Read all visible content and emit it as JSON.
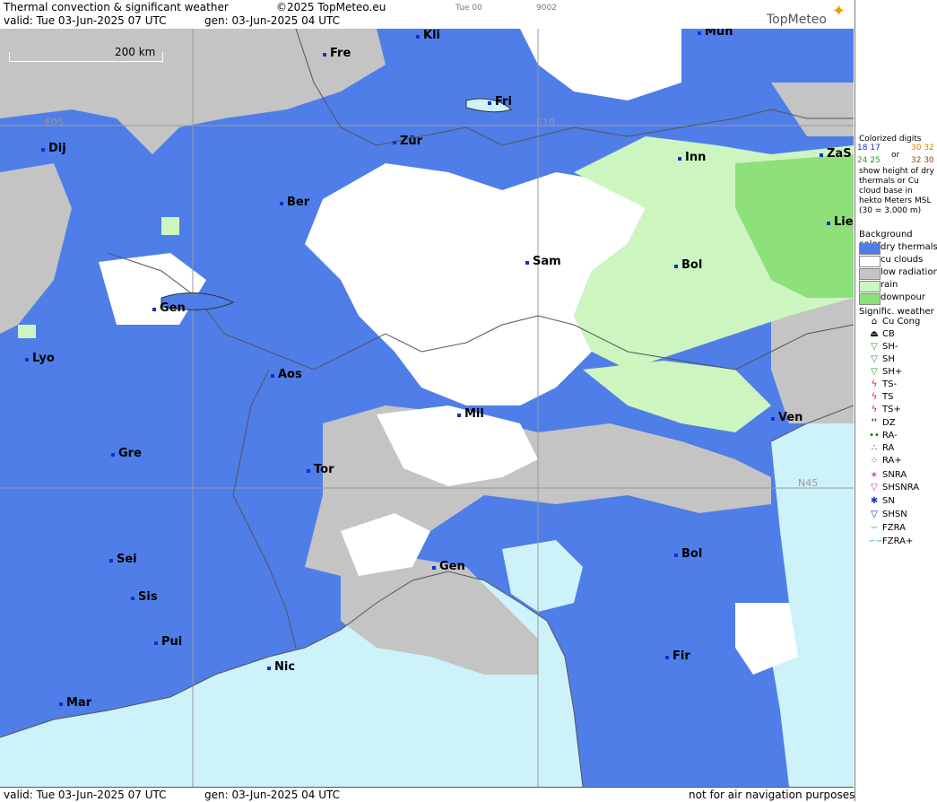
{
  "header": {
    "title": "Thermal convection & significant weather",
    "copyright": "©2025 TopMeteo.eu",
    "time_code": "Tue 00",
    "code": "9002",
    "valid": "valid:  Tue  03-Jun-2025  07 UTC",
    "gen": "gen: 03-Jun-2025 04 UTC",
    "logo": "TopMeteo"
  },
  "footer": {
    "valid": "valid:  Tue  03-Jun-2025  07 UTC",
    "gen": "gen: 03-Jun-2025 04 UTC",
    "note": "not for air navigation purposes"
  },
  "map": {
    "scale_label": "200 km",
    "grid_labels": [
      "E05",
      "E10",
      "N45"
    ],
    "colors": {
      "dry_thermals": "#4f7ee8",
      "cu_clouds": "#ffffff",
      "low_radiation": "#c4c4c4",
      "rain": "#cdf5c0",
      "downpour": "#8ee07a",
      "sea": "#cdf2fa"
    },
    "cities": [
      "Mun",
      "Kli",
      "Fre",
      "Fri",
      "Dij",
      "Zür",
      "Inn",
      "ZaS",
      "Ber",
      "Lie",
      "Sam",
      "Bol",
      "Gen",
      "Lyo",
      "Aos",
      "Mil",
      "Ven",
      "Gre",
      "Tor",
      "Sei",
      "Gen",
      "Bol",
      "Sis",
      "Pui",
      "Nic",
      "Fir",
      "Mar"
    ]
  },
  "legend": {
    "colorized_title": "Colorized digits",
    "colorized_samples": [
      "18 17",
      "30 32",
      "32 30",
      "24 25"
    ],
    "or": "or",
    "colorized_desc": "show height of dry thermals or Cu cloud base in hekto Meters MSL (30 = 3.000 m)",
    "bg_title": "Background color",
    "bg_items": [
      "dry thermals",
      "cu clouds",
      "low radiation",
      "rain",
      "downpour"
    ],
    "sig_title": "Signific. weather",
    "sig_items": [
      {
        "label": "Cu Cong",
        "icon": "cu-cong-icon"
      },
      {
        "label": "CB",
        "icon": "cb-icon"
      },
      {
        "label": "SH-",
        "icon": "shower-light-icon"
      },
      {
        "label": "SH",
        "icon": "shower-icon"
      },
      {
        "label": "SH+",
        "icon": "shower-heavy-icon"
      },
      {
        "label": "TS-",
        "icon": "thunderstorm-light-icon"
      },
      {
        "label": "TS",
        "icon": "thunderstorm-icon"
      },
      {
        "label": "TS+",
        "icon": "thunderstorm-heavy-icon"
      },
      {
        "label": "DZ",
        "icon": "drizzle-icon"
      },
      {
        "label": "RA-",
        "icon": "rain-light-icon"
      },
      {
        "label": "RA",
        "icon": "rain-icon"
      },
      {
        "label": "RA+",
        "icon": "rain-heavy-icon"
      },
      {
        "label": "SNRA",
        "icon": "snow-rain-icon"
      },
      {
        "label": "SHSNRA",
        "icon": "snow-rain-shower-icon"
      },
      {
        "label": "SN",
        "icon": "snow-icon"
      },
      {
        "label": "SHSN",
        "icon": "snow-shower-icon"
      },
      {
        "label": "FZRA",
        "icon": "freezing-rain-icon"
      },
      {
        "label": "FZRA+",
        "icon": "freezing-rain-heavy-icon"
      }
    ]
  }
}
